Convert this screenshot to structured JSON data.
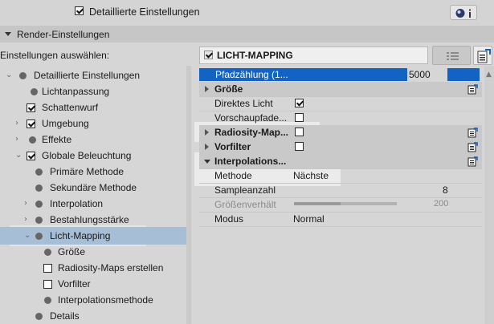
{
  "top": {
    "detailed_label": "Detaillierte Einstellungen"
  },
  "section": {
    "title": "Render-Einstellungen"
  },
  "left": {
    "choose_label": "Einstellungen auswählen:",
    "tree": [
      {
        "label": "Detaillierte Einstellungen"
      },
      {
        "label": "Lichtanpassung"
      },
      {
        "label": "Schattenwurf"
      },
      {
        "label": "Umgebung"
      },
      {
        "label": "Effekte"
      },
      {
        "label": "Globale Beleuchtung"
      },
      {
        "label": "Primäre Methode"
      },
      {
        "label": "Sekundäre Methode"
      },
      {
        "label": "Interpolation"
      },
      {
        "label": "Bestahlungsstärke"
      },
      {
        "label": "Licht-Mapping"
      },
      {
        "label": "Größe"
      },
      {
        "label": "Radiosity-Maps erstellen"
      },
      {
        "label": "Vorfilter"
      },
      {
        "label": "Interpolationsmethode"
      },
      {
        "label": "Details"
      }
    ]
  },
  "right": {
    "panel_title": "LICHT-MAPPING",
    "pfad_label": "Pfadzählung (1...",
    "pfad_value": "5000",
    "rows": {
      "groesse": "Größe",
      "direktes_licht": "Direktes Licht",
      "vorschaupfade": "Vorschaupfade...",
      "radiosity": "Radiosity-Map...",
      "vorfilter": "Vorfilter",
      "interpolations": "Interpolations...",
      "methode_label": "Methode",
      "methode_value": "Nächste",
      "sample_label": "Sampleanzahl",
      "sample_value": "8",
      "groessen_label": "Größenverhält",
      "groessen_value": "200",
      "modus_label": "Modus",
      "modus_value": "Normal"
    },
    "groessenverhaeltnis_level_percent": 45
  },
  "colors": {
    "accent_blue": "#1363c4",
    "selection": "#a7bfd6"
  }
}
